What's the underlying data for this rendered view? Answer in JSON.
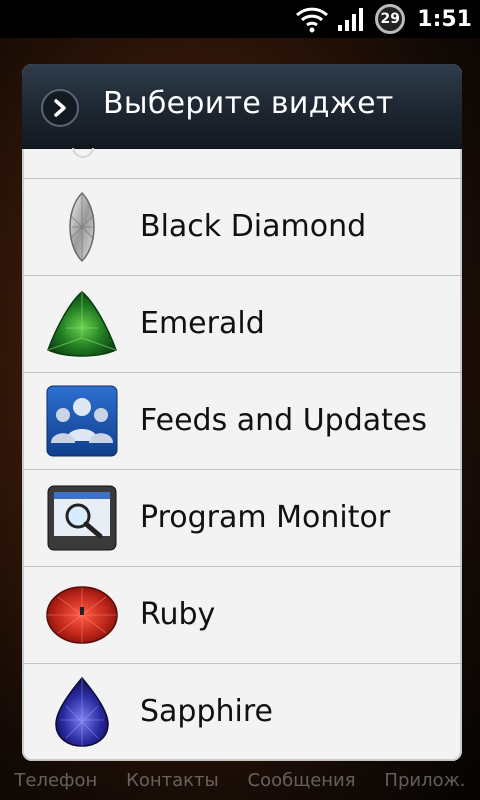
{
  "status": {
    "battery": "29",
    "time": "1:51"
  },
  "dock": [
    "Телефон",
    "Контакты",
    "Сообщения",
    "Прилож."
  ],
  "dialog": {
    "title": "Выберите виджет",
    "items": [
      {
        "label": "Black Diamond",
        "icon": "black-diamond-icon"
      },
      {
        "label": "Emerald",
        "icon": "emerald-icon"
      },
      {
        "label": "Feeds and Updates",
        "icon": "feeds-icon"
      },
      {
        "label": "Program Monitor",
        "icon": "program-monitor-icon"
      },
      {
        "label": "Ruby",
        "icon": "ruby-icon"
      },
      {
        "label": "Sapphire",
        "icon": "sapphire-icon"
      }
    ]
  }
}
